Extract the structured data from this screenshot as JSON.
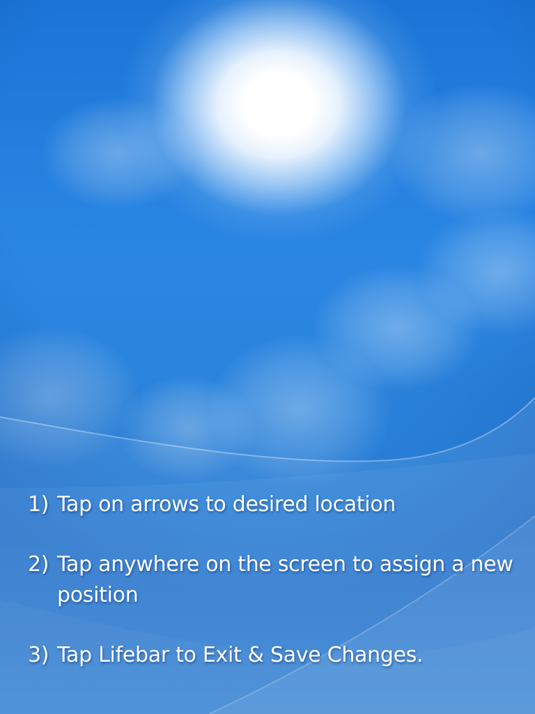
{
  "instructions": {
    "steps": [
      {
        "number": "1)",
        "text": "Tap on arrows to desired location"
      },
      {
        "number": "2)",
        "text": "Tap anywhere on the screen to assign a new position"
      },
      {
        "number": "3)",
        "text": "Tap Lifebar to Exit & Save Changes."
      }
    ]
  },
  "colors": {
    "sky_top": "#1b74d6",
    "sky_bottom": "#46a3f3",
    "text": "#ffffff"
  }
}
